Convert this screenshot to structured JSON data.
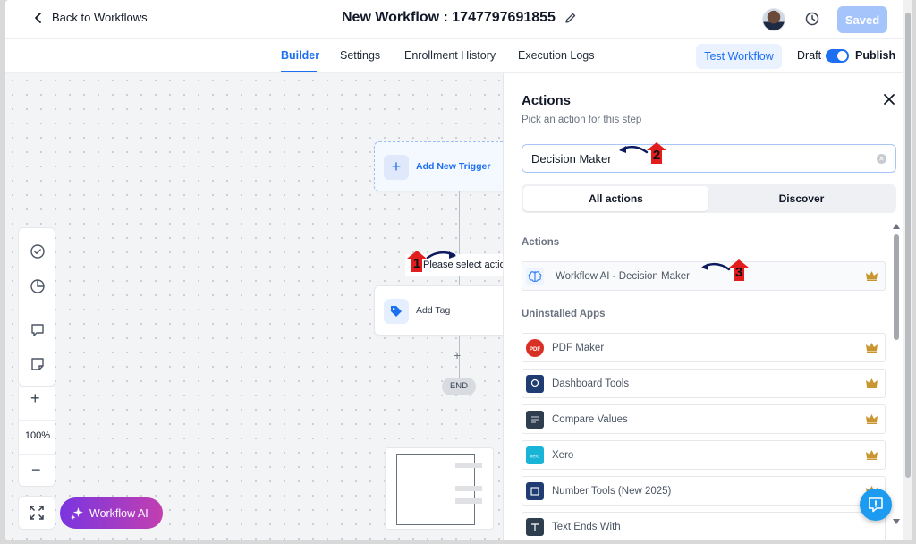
{
  "header": {
    "back_label": "Back to Workflows",
    "title": "New Workflow : 1747797691855",
    "saved_label": "Saved"
  },
  "tabs": [
    {
      "label": "Builder",
      "active": true
    },
    {
      "label": "Settings",
      "active": false
    },
    {
      "label": "Enrollment History",
      "active": false
    },
    {
      "label": "Execution Logs",
      "active": false
    }
  ],
  "toolbar": {
    "test_label": "Test Workflow",
    "draft_label": "Draft",
    "publish_label": "Publish",
    "publish_on": true
  },
  "canvas": {
    "trigger_label": "Add New Trigger",
    "select_action_label": "Please select action",
    "add_tag_label": "Add Tag",
    "end_label": "END",
    "zoom_level": "100%",
    "ai_button_label": "Workflow AI"
  },
  "annotations": [
    "1",
    "2",
    "3"
  ],
  "panel": {
    "title": "Actions",
    "subtitle": "Pick an action for this step",
    "search_value": "Decision Maker",
    "segments": [
      "All actions",
      "Discover"
    ],
    "actions_section": "Actions",
    "actions": [
      {
        "label": "Workflow AI - Decision Maker",
        "icon": "brain-icon"
      }
    ],
    "uninstalled_section": "Uninstalled Apps",
    "apps": [
      {
        "label": "PDF Maker",
        "icon": "pdf-icon",
        "color": "#d93025"
      },
      {
        "label": "Dashboard Tools",
        "icon": "dashboard-app-icon",
        "color": "#1f3d73"
      },
      {
        "label": "Compare Values",
        "icon": "compare-app-icon",
        "color": "#2f3e4e"
      },
      {
        "label": "Xero",
        "icon": "xero-icon",
        "color": "#1ab4d7"
      },
      {
        "label": "Number Tools (New 2025)",
        "icon": "number-tools-icon",
        "color": "#1f3d73"
      },
      {
        "label": "Text Ends With",
        "icon": "text-tools-icon",
        "color": "#2f3e4e"
      }
    ]
  },
  "colors": {
    "accent": "#1d6ff2",
    "ai_gradient_start": "#7a35e0",
    "ai_gradient_end": "#c23fb0",
    "annotation_red": "#e11d1d",
    "annotation_arrow": "#0d1b5e",
    "crown": "#c8952e"
  }
}
